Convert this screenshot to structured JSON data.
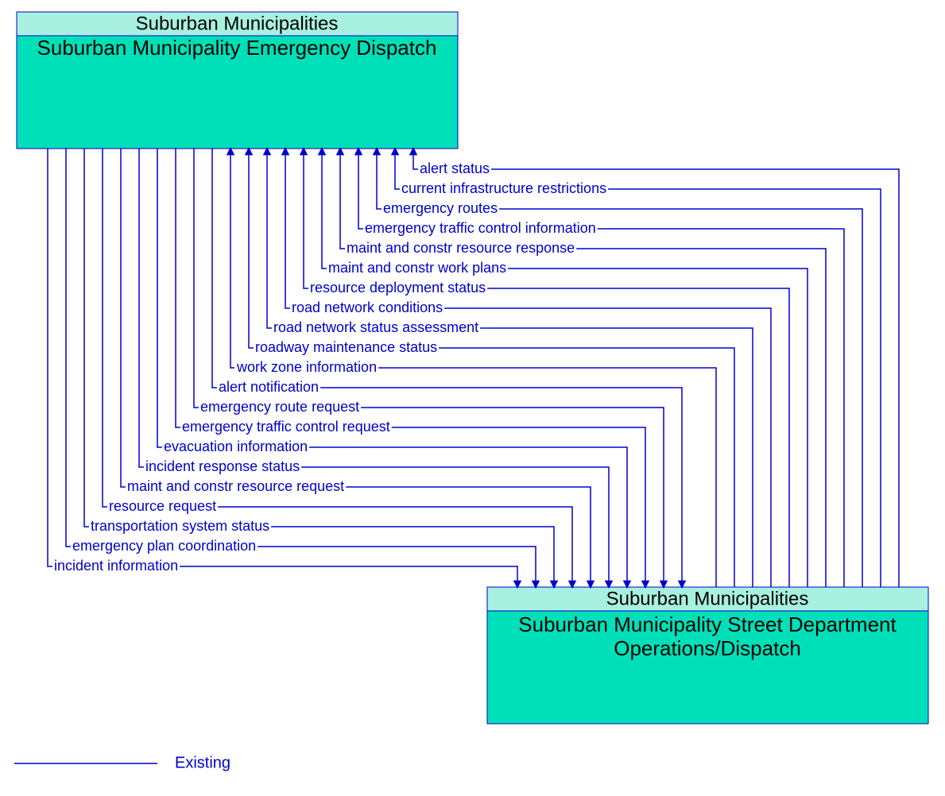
{
  "topBox": {
    "header": "Suburban Municipalities",
    "body": "Suburban Municipality Emergency Dispatch"
  },
  "bottomBox": {
    "header": "Suburban Municipalities",
    "body1": "Suburban Municipality Street Department",
    "body2": "Operations/Dispatch"
  },
  "flowsToTop": [
    {
      "label": "alert status"
    },
    {
      "label": "current infrastructure restrictions"
    },
    {
      "label": "emergency routes"
    },
    {
      "label": "emergency traffic control information"
    },
    {
      "label": "maint and constr resource response"
    },
    {
      "label": "maint and constr work plans"
    },
    {
      "label": "resource deployment status"
    },
    {
      "label": "road network conditions"
    },
    {
      "label": "road network status assessment"
    },
    {
      "label": "roadway maintenance status"
    },
    {
      "label": "work zone information"
    }
  ],
  "flowsToBottom": [
    {
      "label": "alert notification"
    },
    {
      "label": "emergency route request"
    },
    {
      "label": "emergency traffic control request"
    },
    {
      "label": "evacuation information"
    },
    {
      "label": "incident response status"
    },
    {
      "label": "maint and constr resource request"
    },
    {
      "label": "resource request"
    },
    {
      "label": "transportation system status"
    },
    {
      "label": "emergency plan coordination"
    },
    {
      "label": "incident information"
    }
  ],
  "legend": {
    "label": "Existing"
  },
  "colors": {
    "line": "#0000cc",
    "header": "#a8f0e0",
    "body": "#00e0b8"
  }
}
